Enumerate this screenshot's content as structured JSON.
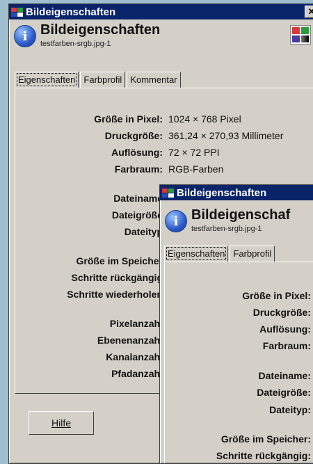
{
  "window1": {
    "title": "Bildeigenschaften",
    "close_glyph": "✕",
    "header_title": "Bildeigenschaften",
    "filename": "testfarben-srgb.jpg-1",
    "tabs": [
      "Eigenschaften",
      "Farbprofil",
      "Kommentar"
    ],
    "labels": {
      "groesse": "Größe in Pixel:",
      "druck": "Druckgröße:",
      "aufl": "Auflösung:",
      "farbraum": "Farbraum:",
      "dateiname": "Dateiname",
      "dateigroesse": "Dateigröße",
      "dateityp": "Dateityp",
      "speicher": "Größe im Speicher",
      "rueck": "Schritte rückgängig",
      "wieder": "Schritte wiederholen",
      "pixelanzahl": "Pixelanzahl",
      "ebenen": "Ebenenanzahl",
      "kanal": "Kanalanzahl",
      "pfad": "Pfadanzahl"
    },
    "values": {
      "groesse": "1024 × 768 Pixel",
      "druck": "361,24 × 270,93 Millimeter",
      "aufl": "72 × 72 PPI",
      "farbraum": "RGB-Farben"
    },
    "help_button": "Hilfe"
  },
  "window2": {
    "title": "Bildeigenschaften",
    "header_title": "Bildeigenschaf",
    "filename": "testfarben-srgb.jpg-1",
    "tabs": [
      "Eigenschaften",
      "Farbprofil"
    ],
    "labels": {
      "groesse": "Größe in Pixel:",
      "druck": "Druckgröße:",
      "aufl": "Auflösung:",
      "farbraum": "Farbraum:",
      "dateiname": "Dateiname:",
      "dateigroesse": "Dateigröße:",
      "dateityp": "Dateityp:",
      "speicher": "Größe im Speicher:",
      "rueck": "Schritte rückgängig:"
    }
  }
}
